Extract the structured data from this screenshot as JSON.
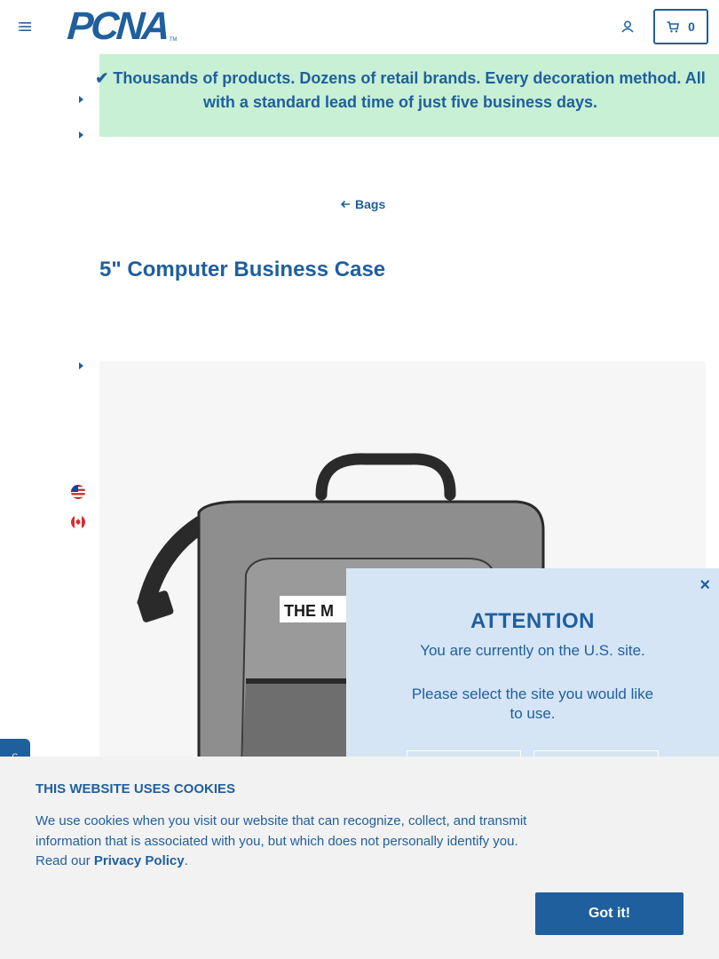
{
  "header": {
    "logo_text": "PCNA",
    "logo_tm": "TM",
    "cart_count": "0"
  },
  "promo": {
    "text": "✔ Thousands of products. Dozens of retail brands. Every decoration method. All with a standard lead time of just five business days."
  },
  "breadcrumb": {
    "back_label": "Bags"
  },
  "product": {
    "title": "5\" Computer Business Case",
    "image_imprint": "THE M"
  },
  "side_tab": {
    "label": "G"
  },
  "attention": {
    "title": "ATTENTION",
    "message": "You are currently on the U.S. site.",
    "question": "Please select the site you would like to use.",
    "close_label": "×"
  },
  "cookie": {
    "title": "THIS WEBSITE USES COOKIES",
    "body": "We use cookies when you visit our website that can recognize, collect, and transmit information that is associated with you, but which does not personally identify you. Read our ",
    "link_label": "Privacy Policy",
    "body_end": ".",
    "button_label": "Got it!"
  },
  "colors": {
    "brand": "#1f5f9e",
    "promo_bg": "#c8f0d4",
    "attention_bg": "#d5e5f5",
    "cookie_bg": "#f2f2f2"
  },
  "icons": [
    "hamburger-menu-icon",
    "account-icon",
    "cart-icon",
    "caret-right-icon",
    "arrow-left-icon",
    "us-flag-icon",
    "canada-flag-icon",
    "close-icon"
  ]
}
